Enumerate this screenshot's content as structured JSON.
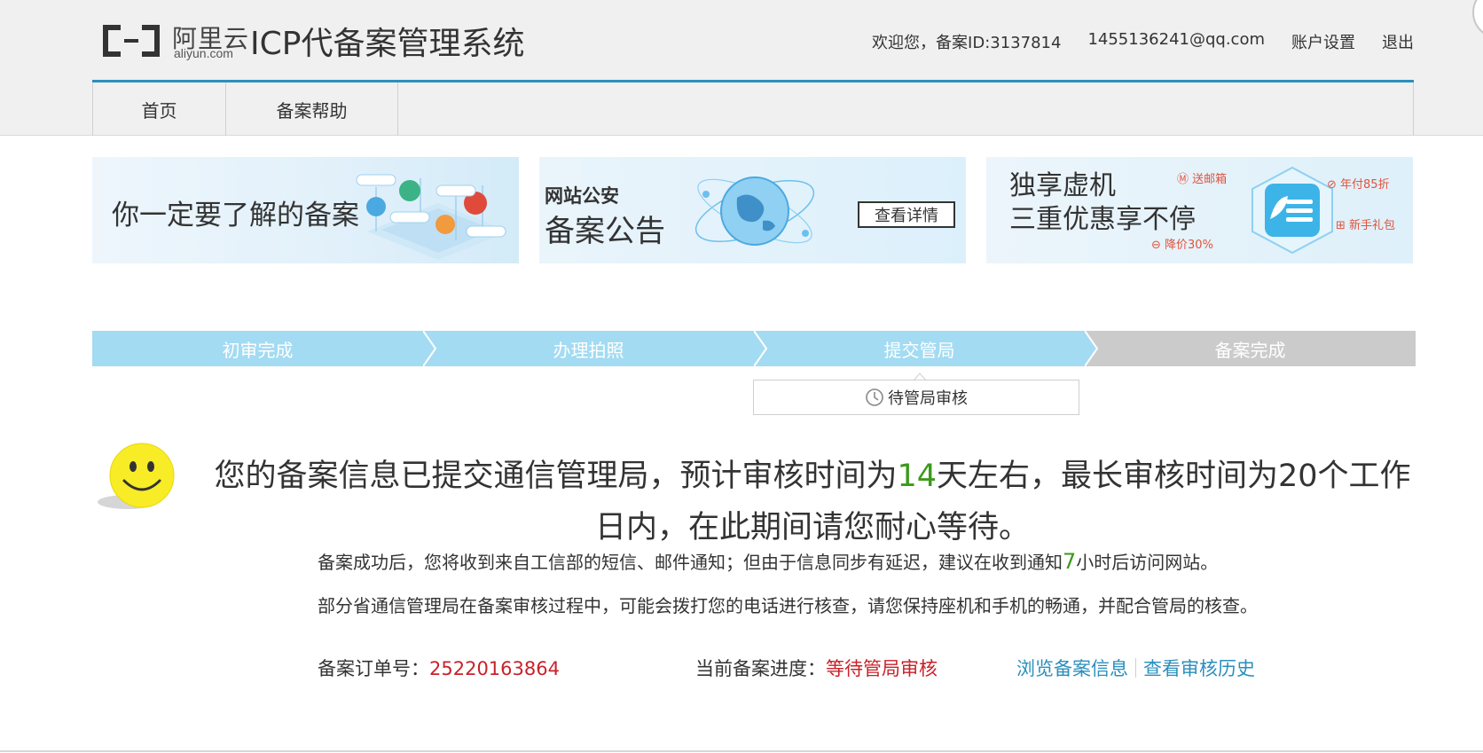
{
  "header": {
    "logo_cn": "阿里云",
    "logo_en": "aliyun.com",
    "system_title": "ICP代备案管理系统",
    "welcome": "欢迎您，备案ID:3137814",
    "email": "1455136241@qq.com",
    "account_settings": "账户设置",
    "logout": "退出"
  },
  "nav": {
    "items": [
      {
        "label": "首页"
      },
      {
        "label": "备案帮助"
      }
    ]
  },
  "banners": {
    "b1": {
      "headline": "你一定要了解的备案"
    },
    "b2": {
      "kicker": "网站公安",
      "headline": "备案公告",
      "button": "查看详情"
    },
    "b3": {
      "line1": "独享虚机",
      "line2": "三重优惠享不停",
      "tag1": "送邮箱",
      "tag2": "年付85折",
      "tag3": "降价30%",
      "tag4": "新手礼包"
    }
  },
  "steps": {
    "items": [
      {
        "label": "初审完成",
        "status": "done"
      },
      {
        "label": "办理拍照",
        "status": "done"
      },
      {
        "label": "提交管局",
        "status": "current"
      },
      {
        "label": "备案完成",
        "status": "pending"
      }
    ],
    "substatus": "待管局审核"
  },
  "message": {
    "part1": "您的备案信息已提交通信管理局，预计审核时间为",
    "days": "14",
    "part2": "天左右，最长审核时间为20个工作日内，在此期间请您耐心等待。",
    "sub1_a": "备案成功后，您将收到来自工信部的短信、邮件通知；但由于信息同步有延迟，建议在收到通知",
    "sub1_num": "7",
    "sub1_b": "小时后访问网站。",
    "sub2": "部分省通信管理局在备案审核过程中，可能会拨打您的电话进行核查，请您保持座机和手机的畅通，并配合管局的核查。"
  },
  "info": {
    "order_label": "备案订单号：",
    "order_value": "25220163864",
    "progress_label": "当前备案进度：",
    "progress_value": "等待管局审核",
    "link_browse": "浏览备案信息",
    "link_history": "查看审核历史"
  },
  "colors": {
    "accent": "#2a8fbd",
    "step_done": "#a3dbf2",
    "step_pending": "#cbcbcb",
    "highlight_green": "#3a9a1a",
    "highlight_red": "#c8222a"
  }
}
